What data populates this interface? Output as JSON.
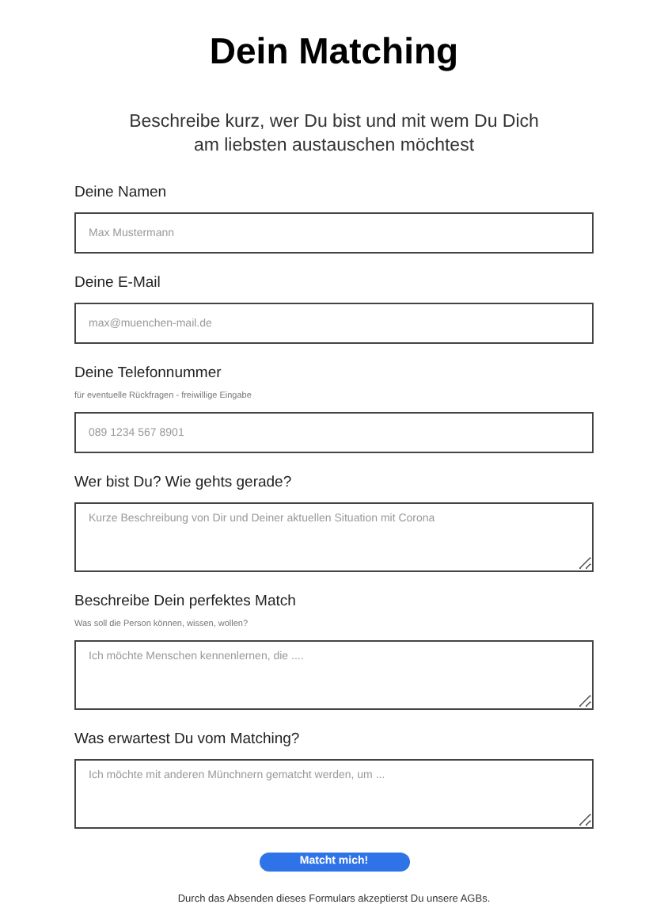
{
  "title": "Dein Matching",
  "subtitle": [
    "Beschreibe kurz, wer Du bist und mit wem Du Dich",
    "am liebsten austauschen möchtest"
  ],
  "fields": [
    {
      "kind": "input",
      "label": "Deine Namen",
      "placeholder": "Max Mustermann"
    },
    {
      "kind": "input",
      "label": "Deine E-Mail",
      "placeholder": "max@muenchen-mail.de"
    },
    {
      "kind": "input",
      "label": "Deine Telefonnummer",
      "hint": "für eventuelle Rückfragen - freiwillige Eingabe",
      "placeholder": "089 1234 567 8901"
    },
    {
      "kind": "textarea",
      "label": "Wer bist Du? Wie gehts gerade?",
      "placeholder": "Kurze Beschreibung von Dir und Deiner aktuellen Situation mit Corona"
    },
    {
      "kind": "textarea",
      "label": "Beschreibe Dein perfektes Match",
      "hint": "Was soll die Person können, wissen, wollen?",
      "placeholder": "Ich möchte Menschen kennenlernen, die ...."
    },
    {
      "kind": "textarea",
      "label": "Was erwartest Du vom Matching?",
      "placeholder": "Ich möchte mit anderen Münchnern gematcht werden, um ..."
    }
  ],
  "submit": "Matcht mich!",
  "footer": "Durch das Absenden dieses Formulars akzeptierst Du unsere AGBs."
}
